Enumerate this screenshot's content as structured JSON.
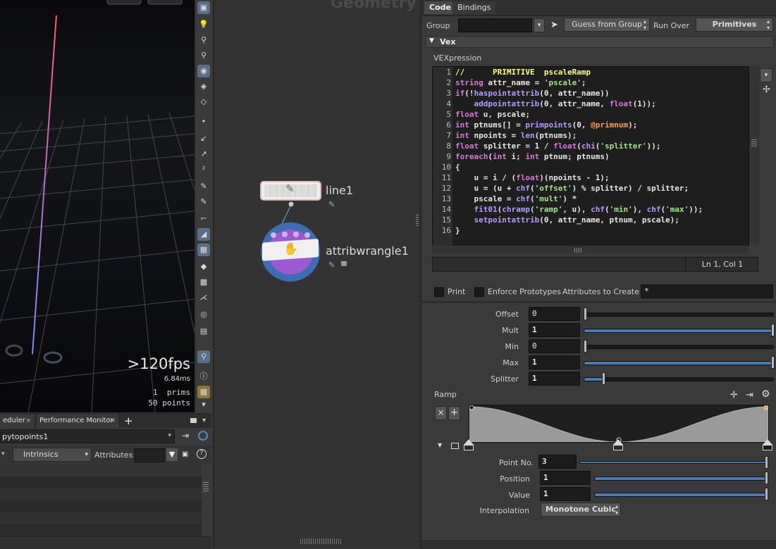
{
  "viewport": {
    "fps": ">120fps",
    "ms": "6.84ms",
    "stats": [
      "1  prims",
      "50 points"
    ],
    "accent_line_top": "#ff5a6e",
    "accent_line_bottom": "#7a8cff"
  },
  "bottom_left": {
    "tabs": [
      "eduler",
      "Performance Monitor"
    ],
    "path_value": "pytopoints1",
    "intrinsics_label": "Intrinsics",
    "attributes_label": "Attributes:"
  },
  "network": {
    "title": "Geometry",
    "nodes": [
      {
        "name": "line1"
      },
      {
        "name": "attribwrangle1"
      }
    ]
  },
  "params": {
    "tabs": [
      "Code",
      "Bindings"
    ],
    "group_label": "Group",
    "group_value": "",
    "guess_button": "Guess from Group",
    "run_over_label": "Run Over",
    "run_over_value": "Primitives",
    "vex_section": "Vex",
    "vexpression_label": "VEXpression",
    "code_lines": [
      "//      PRIMITIVE  pscaleRamp",
      "string attr_name = 'pscale';",
      "if(!haspointattrib(0, attr_name))",
      "    addpointattrib(0, attr_name, float(1));",
      "float u, pscale;",
      "int ptnums[] = primpoints(0, @primnum);",
      "int npoints = len(ptnums);",
      "float splitter = 1 / float(chi('splitter'));",
      "foreach(int i; int ptnum; ptnums)",
      "{",
      "    u = i / (float)(npoints - 1);",
      "    u = (u + chf('offset') % splitter) / splitter;",
      "    pscale = chf('mult') *",
      "    fit01(chramp('ramp', u), chf('min'), chf('max'));",
      "    setpointattrib(0, attr_name, ptnum, pscale);",
      "}"
    ],
    "cursor_pos": "Ln 1, Col 1",
    "print_label": "Print",
    "enforce_label": "Enforce Prototypes",
    "attrs_create_label": "Attributes to Create",
    "attrs_create_value": "*",
    "sliders": [
      {
        "label": "Offset",
        "value": "0",
        "level": 0.0
      },
      {
        "label": "Mult",
        "value": "1",
        "level": 1.0
      },
      {
        "label": "Min",
        "value": "0",
        "level": 0.0
      },
      {
        "label": "Max",
        "value": "1",
        "level": 1.0
      },
      {
        "label": "Splitter",
        "value": "1",
        "level": 0.1
      }
    ],
    "ramp_label": "Ramp",
    "ramp_points": [
      [
        0,
        1
      ],
      [
        0.5,
        0
      ],
      [
        1,
        1
      ]
    ],
    "point_no_label": "Point No.",
    "point_no_value": "3",
    "position_label": "Position",
    "position_value": "1",
    "value_label": "Value",
    "value_value": "1",
    "interp_label": "Interpolation",
    "interp_value": "Monotone Cubic"
  }
}
